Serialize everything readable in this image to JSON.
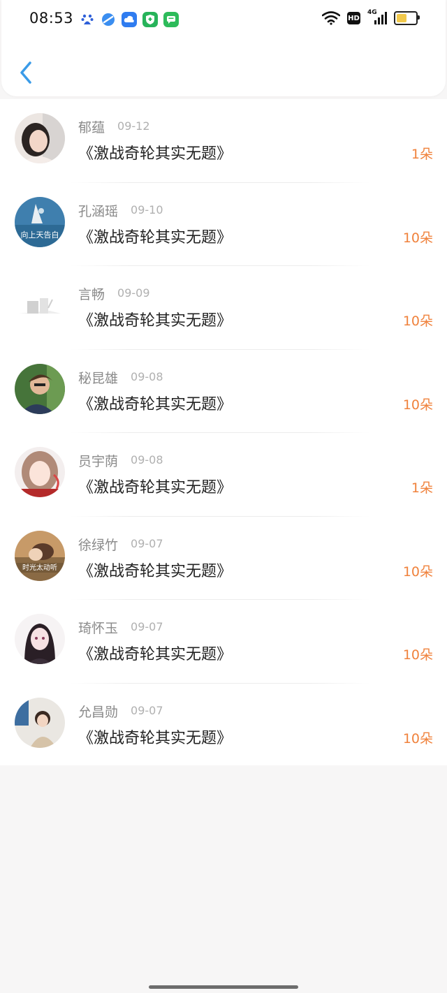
{
  "status_bar": {
    "time": "08:53",
    "app_icons": [
      "baidu-icon",
      "browser-icon",
      "cloud-icon",
      "security-shield-icon",
      "message-icon"
    ],
    "hd_label": "HD",
    "network_label": "4G",
    "battery_level": 0.55
  },
  "header": {
    "back_icon": "chevron-left-icon"
  },
  "colors": {
    "accent": "#3a9be8",
    "amount": "#f0823c",
    "name": "#8a8a8a",
    "title": "#222222"
  },
  "records": [
    {
      "name": "郁蕴",
      "date": "09-12",
      "title": "《激战奇轮其实无题》",
      "amount": "1朵"
    },
    {
      "name": "孔涵瑶",
      "date": "09-10",
      "title": "《激战奇轮其实无题》",
      "amount": "10朵",
      "avatar_text": "向上天告白"
    },
    {
      "name": "言畅",
      "date": "09-09",
      "title": "《激战奇轮其实无题》",
      "amount": "10朵"
    },
    {
      "name": "秘昆雄",
      "date": "09-08",
      "title": "《激战奇轮其实无题》",
      "amount": "10朵"
    },
    {
      "name": "员宇荫",
      "date": "09-08",
      "title": "《激战奇轮其实无题》",
      "amount": "1朵"
    },
    {
      "name": "徐绿竹",
      "date": "09-07",
      "title": "《激战奇轮其实无题》",
      "amount": "10朵",
      "avatar_text": "时光太动听"
    },
    {
      "name": "琦怀玉",
      "date": "09-07",
      "title": "《激战奇轮其实无题》",
      "amount": "10朵"
    },
    {
      "name": "允昌勋",
      "date": "09-07",
      "title": "《激战奇轮其实无题》",
      "amount": "10朵"
    }
  ]
}
